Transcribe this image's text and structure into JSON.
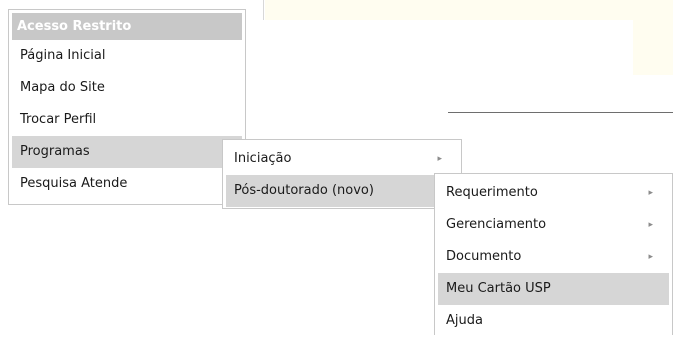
{
  "menu": {
    "header": "Acesso Restrito",
    "items": [
      {
        "label": "Página Inicial"
      },
      {
        "label": "Mapa do Site"
      },
      {
        "label": "Trocar Perfil"
      },
      {
        "label": "Programas",
        "active": true
      },
      {
        "label": "Pesquisa Atende"
      }
    ]
  },
  "submenu_programas": {
    "items": [
      {
        "label": "Iniciação",
        "has_submenu": true
      },
      {
        "label": "Pós-doutorado (novo)",
        "active": true
      }
    ]
  },
  "submenu_posdoc": {
    "items": [
      {
        "label": "Requerimento",
        "has_submenu": true
      },
      {
        "label": "Gerenciamento",
        "has_submenu": true
      },
      {
        "label": "Documento",
        "has_submenu": true
      },
      {
        "label": "Meu Cartão USP",
        "active": true
      },
      {
        "label": "Ajuda"
      }
    ]
  },
  "icons": {
    "submenu_arrow": "submenu-arrow-icon"
  },
  "colors": {
    "header_bg": "#c8c8c8",
    "active_bg": "#d6d6d6",
    "banner_bg": "#fffdf0"
  }
}
